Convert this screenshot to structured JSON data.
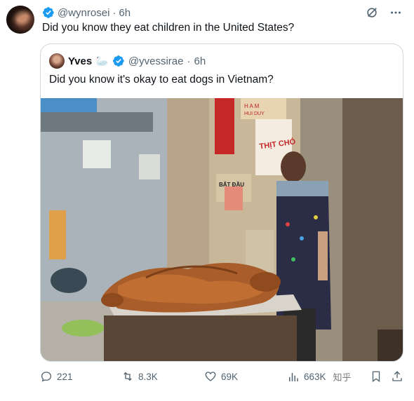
{
  "tweet": {
    "handle": "@wynrosei",
    "separator": "·",
    "time": "6h",
    "text": "Did you know they eat children in the United States?"
  },
  "quote": {
    "name": "Yves",
    "name_emoji": "🦢",
    "handle": "@yvessirae",
    "separator": "·",
    "time": "6h",
    "text": "Did you know it's okay to eat dogs in Vietnam?",
    "photo_signs": {
      "banner": "THỊT CHÓ",
      "shop_left": "BẤT ĐẦU",
      "shop_top": "H A M",
      "shop_sub": "HUI DUY"
    }
  },
  "actions": {
    "replies": "221",
    "reposts": "8.3K",
    "likes": "69K",
    "views": "663K",
    "watermark": "知乎"
  },
  "colors": {
    "verified": "#1d9bf0",
    "text_secondary": "#536471",
    "border": "#cfd9de"
  }
}
